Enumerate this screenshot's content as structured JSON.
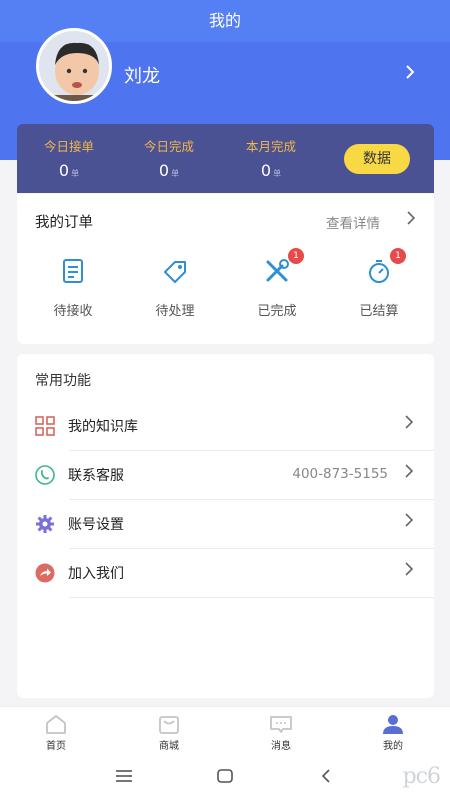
{
  "header": {
    "title": "我的"
  },
  "profile": {
    "name": "刘龙"
  },
  "stats": [
    {
      "label": "今日接单",
      "value": "0",
      "unit": "单"
    },
    {
      "label": "今日完成",
      "value": "0",
      "unit": "单"
    },
    {
      "label": "本月完成",
      "value": "0",
      "unit": "单"
    }
  ],
  "data_button": "数据",
  "orders": {
    "title": "我的订单",
    "more": "查看详情",
    "items": [
      {
        "label": "待接收",
        "icon": "document-icon",
        "badge": ""
      },
      {
        "label": "待处理",
        "icon": "tag-icon",
        "badge": ""
      },
      {
        "label": "已完成",
        "icon": "tools-icon",
        "badge": "1"
      },
      {
        "label": "已结算",
        "icon": "stopwatch-icon",
        "badge": "1"
      }
    ]
  },
  "common": {
    "title": "常用功能",
    "rows": [
      {
        "label": "我的知识库",
        "icon": "grid-icon",
        "value": ""
      },
      {
        "label": "联系客服",
        "icon": "phone-icon",
        "value": "400-873-5155"
      },
      {
        "label": "账号设置",
        "icon": "gear-icon",
        "value": ""
      },
      {
        "label": "加入我们",
        "icon": "share-icon",
        "value": ""
      }
    ]
  },
  "tabs": [
    {
      "label": "首页",
      "icon": "home-icon"
    },
    {
      "label": "商城",
      "icon": "shop-icon"
    },
    {
      "label": "消息",
      "icon": "message-icon"
    },
    {
      "label": "我的",
      "icon": "user-icon"
    }
  ],
  "watermark": "pc6",
  "colors": {
    "primary": "#5580f3",
    "stats_bg": "#4a5294",
    "stats_label": "#f4b54a",
    "data_button": "#f8d943",
    "badge": "#e64a4a"
  }
}
